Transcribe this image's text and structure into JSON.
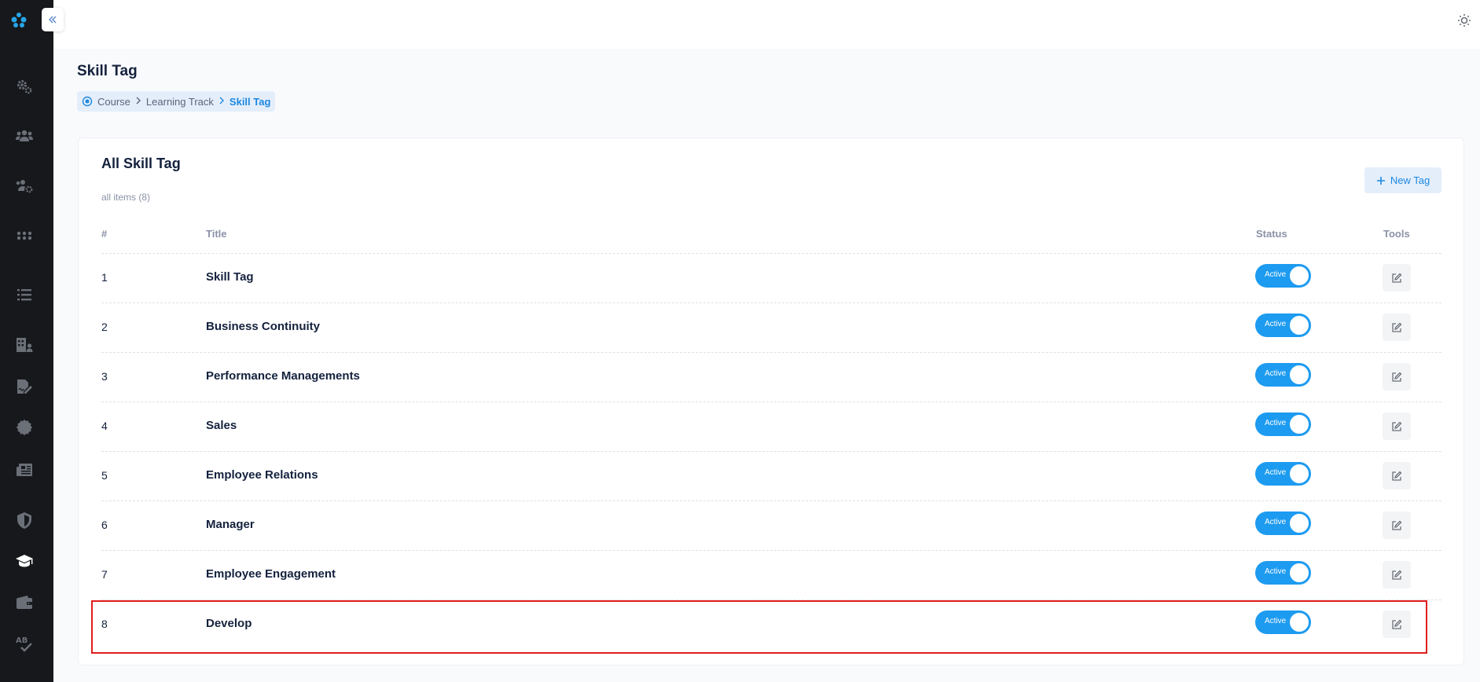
{
  "sidebar": {
    "logo_icon": "app-logo-icon",
    "items": [
      {
        "name": "settings",
        "icon": "gears-icon"
      },
      {
        "name": "users",
        "icon": "users-icon"
      },
      {
        "name": "user-groups-settings",
        "icon": "users-cog-icon"
      },
      {
        "name": "apps",
        "icon": "grid-dots-icon"
      },
      {
        "name": "list",
        "icon": "list-icon"
      },
      {
        "name": "organization",
        "icon": "building-user-icon"
      },
      {
        "name": "forms",
        "icon": "file-signature-icon"
      },
      {
        "name": "certification",
        "icon": "badge-icon"
      },
      {
        "name": "news",
        "icon": "newspaper-icon"
      },
      {
        "name": "security",
        "icon": "shield-icon"
      },
      {
        "name": "courses",
        "icon": "graduation-cap-icon"
      },
      {
        "name": "wallet",
        "icon": "wallet-icon"
      },
      {
        "name": "spellcheck",
        "icon": "spellcheck-icon"
      }
    ]
  },
  "header": {
    "theme_icon": "sun-icon",
    "avatar_icon": "avatar"
  },
  "page": {
    "title": "Skill Tag",
    "breadcrumb": [
      "Course",
      "Learning Track",
      "Skill Tag"
    ]
  },
  "card": {
    "title": "All Skill Tag",
    "subtitle": "all items (8)",
    "new_button": "New Tag",
    "columns": {
      "num": "#",
      "title": "Title",
      "status": "Status",
      "tools": "Tools"
    },
    "rows": [
      {
        "num": "1",
        "title": "Skill Tag",
        "status": "Active"
      },
      {
        "num": "2",
        "title": "Business Continuity",
        "status": "Active"
      },
      {
        "num": "3",
        "title": "Performance Managements",
        "status": "Active"
      },
      {
        "num": "4",
        "title": "Sales",
        "status": "Active"
      },
      {
        "num": "5",
        "title": "Employee Relations",
        "status": "Active"
      },
      {
        "num": "6",
        "title": "Manager",
        "status": "Active"
      },
      {
        "num": "7",
        "title": "Employee Engagement",
        "status": "Active"
      },
      {
        "num": "8",
        "title": "Develop",
        "status": "Active"
      }
    ]
  },
  "colors": {
    "accent": "#1d9bf0",
    "sidebar": "#17181b",
    "highlight": "#e11d1d"
  }
}
